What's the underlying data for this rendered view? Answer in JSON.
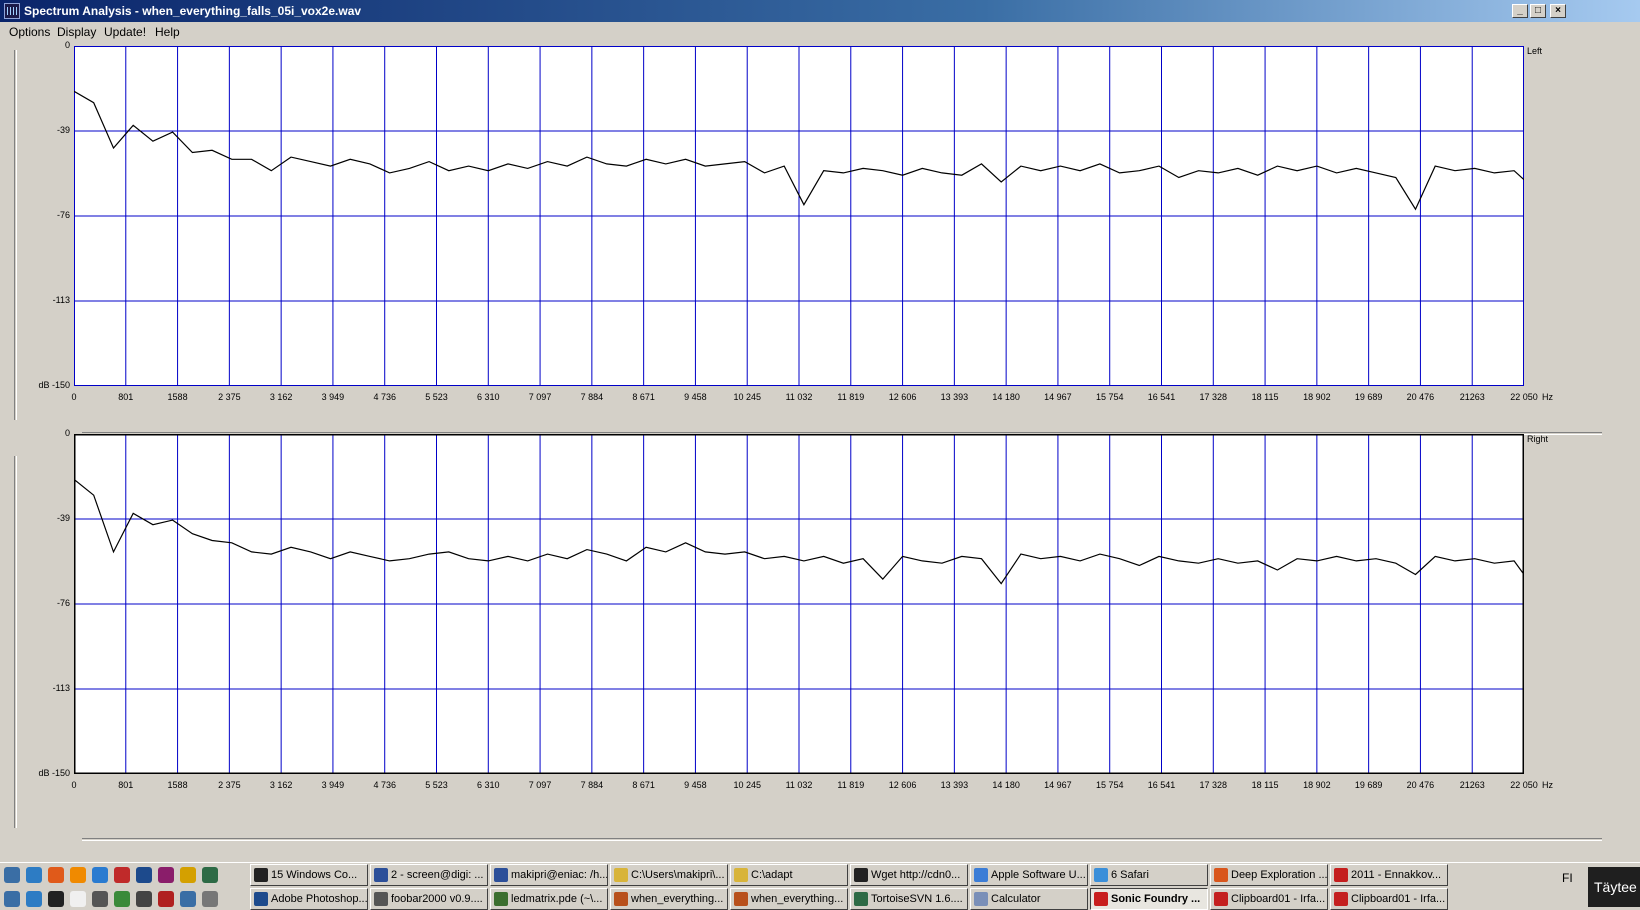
{
  "window": {
    "title": "Spectrum Analysis - when_everything_falls_05i_vox2e.wav",
    "buttons": [
      "_",
      "□",
      "×"
    ]
  },
  "menu": [
    "Options",
    "Display",
    "Update!",
    "Help"
  ],
  "chart_data": [
    {
      "type": "line",
      "channel": "Left",
      "ylabel": "dB",
      "yticks": [
        "0",
        "-39",
        "-76",
        "-113",
        "dB -150"
      ],
      "ylim": [
        -150,
        0
      ],
      "xticks": [
        "0",
        "801",
        "1588",
        "2 375",
        "3 162",
        "3 949",
        "4 736",
        "5 523",
        "6 310",
        "7 097",
        "7 884",
        "8 671",
        "9 458",
        "10 245",
        "11 032",
        "11 819",
        "12 606",
        "13 393",
        "14 180",
        "14 967",
        "15 754",
        "16 541",
        "17 328",
        "18 115",
        "18 902",
        "19 689",
        "20 476",
        "21263",
        "22 050"
      ],
      "xunit": "Hz",
      "xlim": [
        0,
        22050
      ],
      "grid": true,
      "series": [
        {
          "x": [
            0,
            300,
            600,
            900,
            1200,
            1500,
            1800,
            2100,
            2400,
            2700,
            3000,
            3300,
            3600,
            3900,
            4200,
            4500,
            4800,
            5100,
            5400,
            5700,
            6000,
            6300,
            6600,
            6900,
            7200,
            7500,
            7800,
            8100,
            8400,
            8700,
            9000,
            9300,
            9600,
            9900,
            10200,
            10500,
            10800,
            11100,
            11400,
            11700,
            12000,
            12300,
            12600,
            12900,
            13200,
            13500,
            13800,
            14100,
            14400,
            14700,
            15000,
            15300,
            15600,
            15900,
            16200,
            16500,
            16800,
            17100,
            17400,
            17700,
            18000,
            18300,
            18600,
            18900,
            19200,
            19500,
            19800,
            20100,
            20400,
            20700,
            21000,
            21300,
            21600,
            21900,
            22050
          ],
          "values": [
            -20,
            -25,
            -45,
            -35,
            -42,
            -38,
            -47,
            -46,
            -50,
            -50,
            -55,
            -49,
            -51,
            -53,
            -50,
            -52,
            -56,
            -54,
            -51,
            -55,
            -53,
            -55,
            -52,
            -54,
            -51,
            -53,
            -49,
            -52,
            -53,
            -50,
            -52,
            -50,
            -53,
            -52,
            -51,
            -56,
            -53,
            -70,
            -55,
            -56,
            -54,
            -55,
            -57,
            -54,
            -56,
            -57,
            -52,
            -60,
            -53,
            -55,
            -53,
            -55,
            -52,
            -56,
            -55,
            -53,
            -58,
            -55,
            -56,
            -54,
            -57,
            -53,
            -55,
            -53,
            -56,
            -54,
            -56,
            -58,
            -72,
            -53,
            -55,
            -54,
            -56,
            -55,
            -59
          ]
        }
      ]
    },
    {
      "type": "line",
      "channel": "Right",
      "ylabel": "dB",
      "yticks": [
        "0",
        "-39",
        "-76",
        "-113",
        "dB -150"
      ],
      "ylim": [
        -150,
        0
      ],
      "xticks": [
        "0",
        "801",
        "1588",
        "2 375",
        "3 162",
        "3 949",
        "4 736",
        "5 523",
        "6 310",
        "7 097",
        "7 884",
        "8 671",
        "9 458",
        "10 245",
        "11 032",
        "11 819",
        "12 606",
        "13 393",
        "14 180",
        "14 967",
        "15 754",
        "16 541",
        "17 328",
        "18 115",
        "18 902",
        "19 689",
        "20 476",
        "21263",
        "22 050"
      ],
      "xunit": "Hz",
      "xlim": [
        0,
        22050
      ],
      "grid": true,
      "series": [
        {
          "x": [
            0,
            300,
            600,
            900,
            1200,
            1500,
            1800,
            2100,
            2400,
            2700,
            3000,
            3300,
            3600,
            3900,
            4200,
            4500,
            4800,
            5100,
            5400,
            5700,
            6000,
            6300,
            6600,
            6900,
            7200,
            7500,
            7800,
            8100,
            8400,
            8700,
            9000,
            9300,
            9600,
            9900,
            10200,
            10500,
            10800,
            11100,
            11400,
            11700,
            12000,
            12300,
            12600,
            12900,
            13200,
            13500,
            13800,
            14100,
            14400,
            14700,
            15000,
            15300,
            15600,
            15900,
            16200,
            16500,
            16800,
            17100,
            17400,
            17700,
            18000,
            18300,
            18600,
            18900,
            19200,
            19500,
            19800,
            20100,
            20400,
            20700,
            21000,
            21300,
            21600,
            21900,
            22050
          ],
          "values": [
            -20,
            -27,
            -52,
            -35,
            -40,
            -38,
            -44,
            -47,
            -48,
            -52,
            -53,
            -50,
            -52,
            -55,
            -52,
            -54,
            -56,
            -55,
            -53,
            -52,
            -55,
            -56,
            -54,
            -56,
            -53,
            -55,
            -51,
            -53,
            -56,
            -50,
            -52,
            -48,
            -52,
            -53,
            -52,
            -55,
            -54,
            -56,
            -54,
            -57,
            -55,
            -64,
            -54,
            -56,
            -57,
            -54,
            -55,
            -66,
            -53,
            -55,
            -54,
            -56,
            -53,
            -55,
            -58,
            -54,
            -56,
            -57,
            -55,
            -57,
            -56,
            -60,
            -55,
            -56,
            -54,
            -56,
            -55,
            -57,
            -62,
            -54,
            -56,
            -55,
            -57,
            -56,
            -62
          ]
        }
      ]
    }
  ],
  "colors": {
    "grid": "#0000c8",
    "trace": "#000000",
    "plot_bg": "#ffffff"
  },
  "taskbar": {
    "top_row": [
      {
        "label": "15 Windows Co...",
        "icon": "console-icon"
      },
      {
        "label": "2 - screen@digi: ...",
        "icon": "putty-icon"
      },
      {
        "label": "makipri@eniac: /h...",
        "icon": "putty-icon"
      },
      {
        "label": "C:\\Users\\makipri\\...",
        "icon": "folder-icon"
      },
      {
        "label": "C:\\adapt",
        "icon": "folder-icon"
      },
      {
        "label": "Wget http://cdn0...",
        "icon": "console-icon"
      },
      {
        "label": "Apple Software U...",
        "icon": "apple-update-icon"
      },
      {
        "label": "6 Safari",
        "icon": "safari-icon"
      },
      {
        "label": "Deep Exploration ...",
        "icon": "deep-exploration-icon"
      },
      {
        "label": "2011 - Ennakkov...",
        "icon": "pdf-icon"
      }
    ],
    "bottom_row": [
      {
        "label": "Adobe Photoshop...",
        "icon": "photoshop-icon"
      },
      {
        "label": "foobar2000 v0.9....",
        "icon": "foobar-icon"
      },
      {
        "label": "ledmatrix.pde (~\\...",
        "icon": "editor-icon"
      },
      {
        "label": "when_everything...",
        "icon": "audio-icon"
      },
      {
        "label": "when_everything...",
        "icon": "audio-icon"
      },
      {
        "label": "TortoiseSVN 1.6....",
        "icon": "tortoise-icon"
      },
      {
        "label": "Calculator",
        "icon": "calculator-icon"
      },
      {
        "label": "Sonic Foundry ...",
        "icon": "sonic-foundry-icon"
      },
      {
        "label": "Clipboard01 - Irfa...",
        "icon": "irfanview-icon"
      },
      {
        "label": "Clipboard01 - Irfa...",
        "icon": "irfanview-icon"
      }
    ],
    "lang": "FI",
    "clock": "Täytee"
  }
}
